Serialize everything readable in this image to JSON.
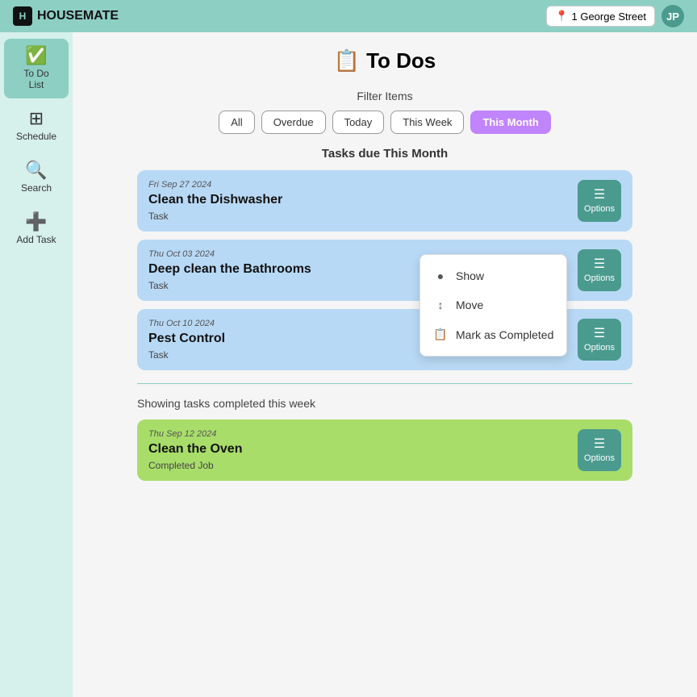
{
  "header": {
    "logo_text": "HOUSEMATE",
    "address_label": "1 George Street",
    "avatar_initials": "JP",
    "location_icon": "📍"
  },
  "sidebar": {
    "items": [
      {
        "id": "todo",
        "label": "To Do\nList",
        "icon": "📋",
        "active": true
      },
      {
        "id": "schedule",
        "label": "Schedule",
        "icon": "📅",
        "active": false
      },
      {
        "id": "search",
        "label": "Search",
        "icon": "🔍",
        "active": false
      },
      {
        "id": "add-task",
        "label": "Add Task",
        "icon": "➕",
        "active": false
      }
    ]
  },
  "main": {
    "page_title": "To Dos",
    "page_icon": "📋",
    "filter": {
      "label": "Filter Items",
      "buttons": [
        {
          "id": "all",
          "label": "All",
          "active": false
        },
        {
          "id": "overdue",
          "label": "Overdue",
          "active": false
        },
        {
          "id": "today",
          "label": "Today",
          "active": false
        },
        {
          "id": "this-week",
          "label": "This Week",
          "active": false
        },
        {
          "id": "this-month",
          "label": "This Month",
          "active": true
        }
      ]
    },
    "tasks_section_heading": "Tasks due This Month",
    "tasks": [
      {
        "id": 1,
        "date": "Fri Sep 27 2024",
        "title": "Clean the Dishwasher",
        "type": "Task",
        "completed": false
      },
      {
        "id": 2,
        "date": "Thu Oct 03 2024",
        "title": "Deep clean the Bathrooms",
        "type": "Task",
        "completed": false
      },
      {
        "id": 3,
        "date": "Thu Oct 10 2024",
        "title": "Pest Control",
        "type": "Task",
        "completed": false
      }
    ],
    "completed_label": "Showing tasks completed this week",
    "completed_tasks": [
      {
        "id": 4,
        "date": "Thu Sep 12 2024",
        "title": "Clean the Oven",
        "type": "Completed Job",
        "completed": true
      }
    ],
    "options_label": "Options",
    "dropdown": {
      "items": [
        {
          "id": "show",
          "label": "Show",
          "icon": "●"
        },
        {
          "id": "move",
          "label": "Move",
          "icon": "↕"
        },
        {
          "id": "mark-completed",
          "label": "Mark as Completed",
          "icon": "📋"
        }
      ]
    }
  }
}
